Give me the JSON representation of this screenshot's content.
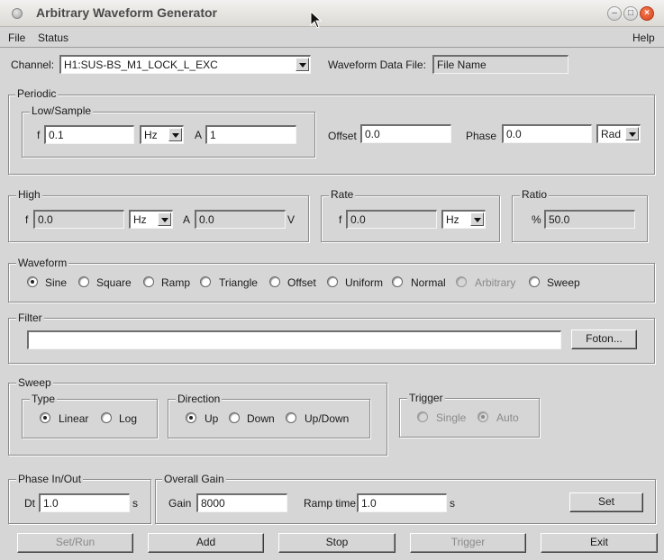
{
  "window": {
    "title": "Arbitrary Waveform Generator",
    "minimize": "–",
    "maximize": "□",
    "close": "×"
  },
  "menu": {
    "file": "File",
    "status": "Status",
    "help": "Help"
  },
  "channel": {
    "label": "Channel:",
    "value": "H1:SUS-BS_M1_LOCK_L_EXC",
    "data_file_label": "Waveform Data File:",
    "data_file_value": "File Name"
  },
  "periodic": {
    "title": "Periodic",
    "low_sample": {
      "title": "Low/Sample",
      "f_label": "f",
      "f_value": "0.1",
      "f_unit": "Hz",
      "a_label": "A",
      "a_value": "1"
    },
    "offset_label": "Offset",
    "offset_value": "0.0",
    "phase_label": "Phase",
    "phase_value": "0.0",
    "phase_unit": "Rad"
  },
  "high": {
    "title": "High",
    "f_label": "f",
    "f_value": "0.0",
    "f_unit": "Hz",
    "a_label": "A",
    "a_value": "0.0",
    "a_unit": "V"
  },
  "rate": {
    "title": "Rate",
    "f_label": "f",
    "f_value": "0.0",
    "f_unit": "Hz"
  },
  "ratio": {
    "title": "Ratio",
    "label": "%",
    "value": "50.0"
  },
  "waveform": {
    "title": "Waveform",
    "options": [
      {
        "label": "Sine",
        "selected": true,
        "disabled": false
      },
      {
        "label": "Square",
        "selected": false,
        "disabled": false
      },
      {
        "label": "Ramp",
        "selected": false,
        "disabled": false
      },
      {
        "label": "Triangle",
        "selected": false,
        "disabled": false
      },
      {
        "label": "Offset",
        "selected": false,
        "disabled": false
      },
      {
        "label": "Uniform",
        "selected": false,
        "disabled": false
      },
      {
        "label": "Normal",
        "selected": false,
        "disabled": false
      },
      {
        "label": "Arbitrary",
        "selected": false,
        "disabled": true
      },
      {
        "label": "Sweep",
        "selected": false,
        "disabled": false
      }
    ]
  },
  "filter": {
    "title": "Filter",
    "value": "",
    "foton_label": "Foton..."
  },
  "sweep": {
    "title": "Sweep",
    "type": {
      "title": "Type",
      "options": [
        "Linear",
        "Log"
      ],
      "selected": "Linear"
    },
    "direction": {
      "title": "Direction",
      "options": [
        "Up",
        "Down",
        "Up/Down"
      ],
      "selected": "Up"
    }
  },
  "trigger": {
    "title": "Trigger",
    "options": [
      "Single",
      "Auto"
    ],
    "selected": "Auto"
  },
  "phase_inout": {
    "title": "Phase In/Out",
    "dt_label": "Dt",
    "dt_value": "1.0",
    "dt_unit": "s"
  },
  "overall_gain": {
    "title": "Overall Gain",
    "gain_label": "Gain",
    "gain_value": "8000",
    "ramp_label": "Ramp time",
    "ramp_value": "1.0",
    "ramp_unit": "s",
    "set_label": "Set"
  },
  "buttons": {
    "setrun": "Set/Run",
    "add": "Add",
    "stop": "Stop",
    "trigger": "Trigger",
    "exit": "Exit"
  }
}
